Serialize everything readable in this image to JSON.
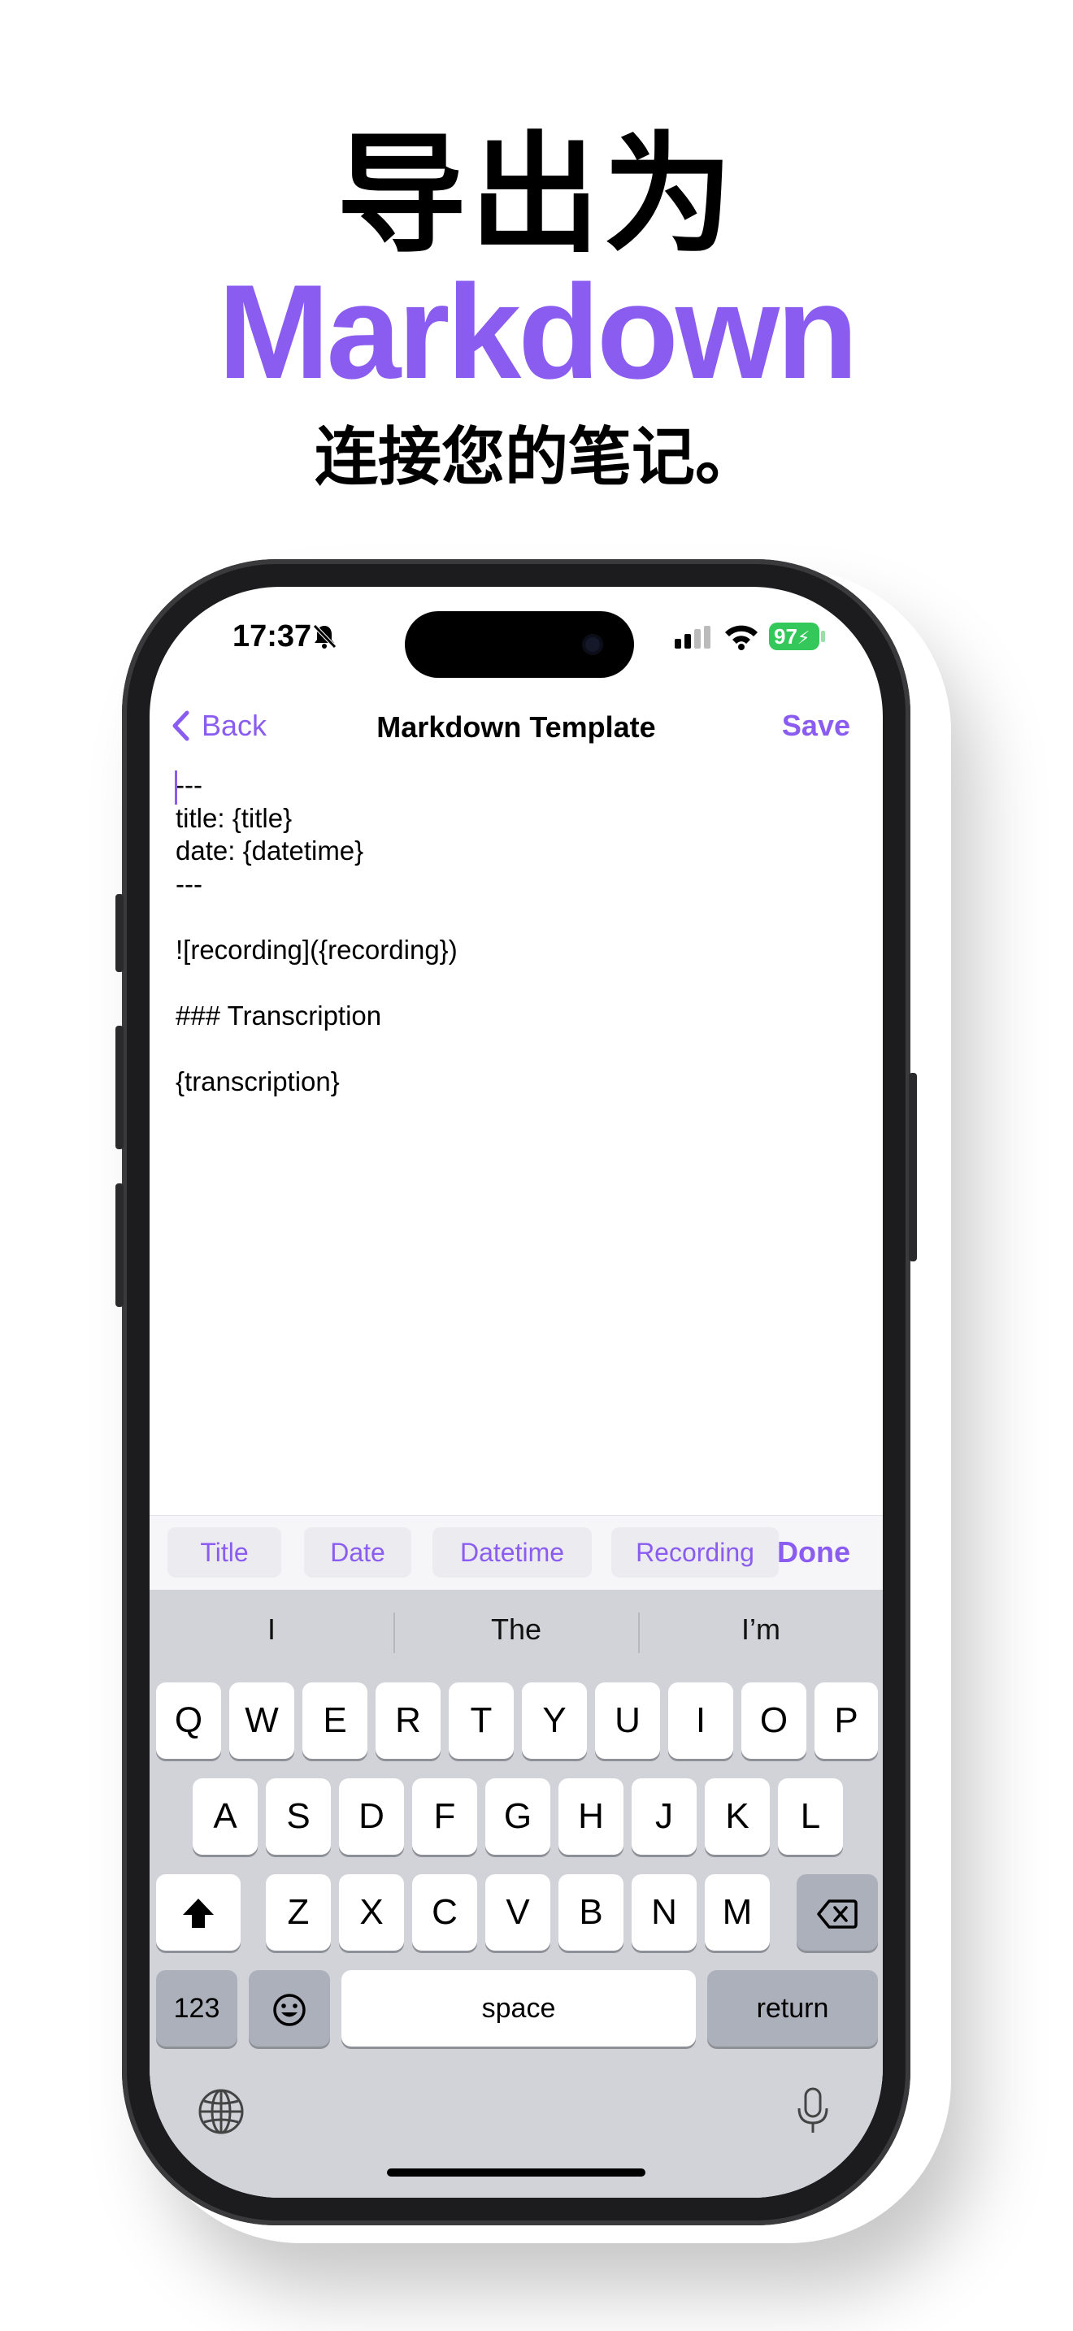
{
  "hero": {
    "title": "导出为",
    "accent": "Markdown",
    "subtitle": "连接您的笔记。",
    "accent_color": "#8b5cf0"
  },
  "status_bar": {
    "time": "17:37",
    "battery": "97"
  },
  "nav": {
    "back_label": "Back",
    "title": "Markdown Template",
    "save_label": "Save"
  },
  "editor": {
    "text": "---\ntitle: {title}\ndate: {datetime}\n---\n\n![recording]({recording})\n\n### Transcription\n\n{transcription}"
  },
  "accessory": {
    "chips": [
      "Title",
      "Date",
      "Datetime",
      "Recording"
    ],
    "done_label": "Done"
  },
  "keyboard": {
    "suggestions": [
      "I",
      "The",
      "I’m"
    ],
    "row1": [
      "Q",
      "W",
      "E",
      "R",
      "T",
      "Y",
      "U",
      "I",
      "O",
      "P"
    ],
    "row2": [
      "A",
      "S",
      "D",
      "F",
      "G",
      "H",
      "J",
      "K",
      "L"
    ],
    "row3": [
      "Z",
      "X",
      "C",
      "V",
      "B",
      "N",
      "M"
    ],
    "numbers_label": "123",
    "space_label": "space",
    "return_label": "return",
    "icons": [
      "shift-icon",
      "delete-icon",
      "emoji-icon",
      "globe-icon",
      "microphone-icon"
    ]
  }
}
